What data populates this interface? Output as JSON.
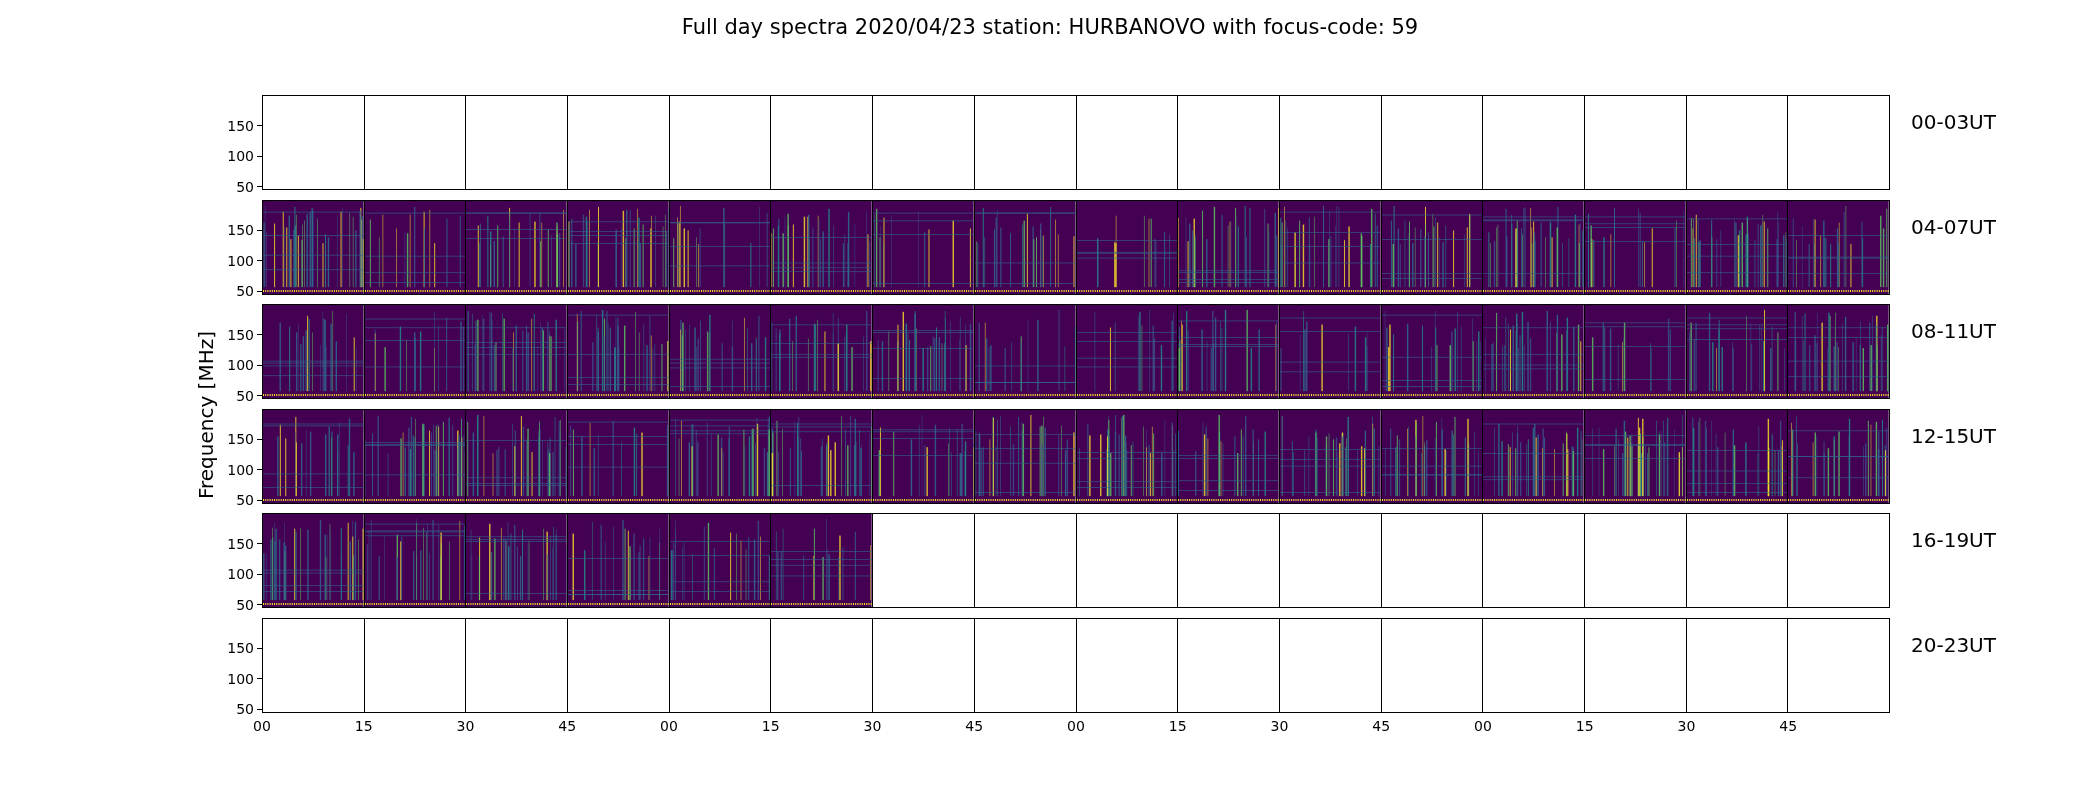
{
  "title": "Full day spectra 2020/04/23 station: HURBANOVO with focus-code: 59",
  "ylabel": "Frequency [MHz]",
  "rows": [
    {
      "label": "00-03UT",
      "yticks": [
        "150",
        "100",
        "50"
      ],
      "panels": [
        {
          "kind": "blank"
        },
        {
          "kind": "blank"
        },
        {
          "kind": "blank"
        },
        {
          "kind": "blank"
        },
        {
          "kind": "blank"
        },
        {
          "kind": "blank"
        },
        {
          "kind": "blank"
        },
        {
          "kind": "blank"
        },
        {
          "kind": "blank"
        },
        {
          "kind": "blank"
        },
        {
          "kind": "blank"
        },
        {
          "kind": "blank"
        },
        {
          "kind": "blank"
        },
        {
          "kind": "blank"
        },
        {
          "kind": "blank"
        },
        {
          "kind": "blank"
        }
      ]
    },
    {
      "label": "04-07UT",
      "yticks": [
        "150",
        "100",
        "50"
      ],
      "panels": [
        {
          "kind": "spectrum"
        },
        {
          "kind": "spectrum"
        },
        {
          "kind": "spectrum"
        },
        {
          "kind": "spectrum"
        },
        {
          "kind": "spectrum"
        },
        {
          "kind": "spectrum"
        },
        {
          "kind": "spectrum"
        },
        {
          "kind": "spectrum"
        },
        {
          "kind": "spectrum"
        },
        {
          "kind": "spectrum"
        },
        {
          "kind": "spectrum"
        },
        {
          "kind": "spectrum"
        },
        {
          "kind": "spectrum"
        },
        {
          "kind": "spectrum"
        },
        {
          "kind": "spectrum"
        },
        {
          "kind": "spectrum"
        }
      ]
    },
    {
      "label": "08-11UT",
      "yticks": [
        "150",
        "100",
        "50"
      ],
      "panels": [
        {
          "kind": "spectrum"
        },
        {
          "kind": "spectrum"
        },
        {
          "kind": "spectrum"
        },
        {
          "kind": "spectrum"
        },
        {
          "kind": "spectrum"
        },
        {
          "kind": "spectrum"
        },
        {
          "kind": "spectrum"
        },
        {
          "kind": "spectrum"
        },
        {
          "kind": "spectrum"
        },
        {
          "kind": "spectrum"
        },
        {
          "kind": "spectrum"
        },
        {
          "kind": "spectrum"
        },
        {
          "kind": "spectrum"
        },
        {
          "kind": "spectrum"
        },
        {
          "kind": "spectrum"
        },
        {
          "kind": "spectrum"
        }
      ]
    },
    {
      "label": "12-15UT",
      "yticks": [
        "150",
        "100",
        "50"
      ],
      "panels": [
        {
          "kind": "spectrum"
        },
        {
          "kind": "spectrum"
        },
        {
          "kind": "spectrum"
        },
        {
          "kind": "spectrum"
        },
        {
          "kind": "spectrum"
        },
        {
          "kind": "spectrum"
        },
        {
          "kind": "spectrum"
        },
        {
          "kind": "spectrum"
        },
        {
          "kind": "spectrum"
        },
        {
          "kind": "spectrum"
        },
        {
          "kind": "spectrum"
        },
        {
          "kind": "spectrum"
        },
        {
          "kind": "spectrum"
        },
        {
          "kind": "spectrum"
        },
        {
          "kind": "spectrum"
        },
        {
          "kind": "spectrum"
        }
      ]
    },
    {
      "label": "16-19UT",
      "yticks": [
        "150",
        "100",
        "50"
      ],
      "panels": [
        {
          "kind": "spectrum"
        },
        {
          "kind": "spectrum"
        },
        {
          "kind": "spectrum"
        },
        {
          "kind": "spectrum"
        },
        {
          "kind": "spectrum"
        },
        {
          "kind": "spectrum"
        },
        {
          "kind": "blank"
        },
        {
          "kind": "blank"
        },
        {
          "kind": "blank"
        },
        {
          "kind": "blank"
        },
        {
          "kind": "blank"
        },
        {
          "kind": "blank"
        },
        {
          "kind": "blank"
        },
        {
          "kind": "blank"
        },
        {
          "kind": "blank"
        },
        {
          "kind": "blank"
        }
      ]
    },
    {
      "label": "20-23UT",
      "yticks": [
        "150",
        "100",
        "50"
      ],
      "panels": [
        {
          "kind": "blank"
        },
        {
          "kind": "blank"
        },
        {
          "kind": "blank"
        },
        {
          "kind": "blank"
        },
        {
          "kind": "blank"
        },
        {
          "kind": "blank"
        },
        {
          "kind": "blank"
        },
        {
          "kind": "blank"
        },
        {
          "kind": "blank"
        },
        {
          "kind": "blank"
        },
        {
          "kind": "blank"
        },
        {
          "kind": "blank"
        },
        {
          "kind": "blank"
        },
        {
          "kind": "blank"
        },
        {
          "kind": "blank"
        },
        {
          "kind": "blank"
        }
      ]
    }
  ],
  "xticks": [
    "00",
    "15",
    "30",
    "45",
    "00",
    "15",
    "30",
    "45",
    "00",
    "15",
    "30",
    "45",
    "00",
    "15",
    "30",
    "45"
  ]
}
